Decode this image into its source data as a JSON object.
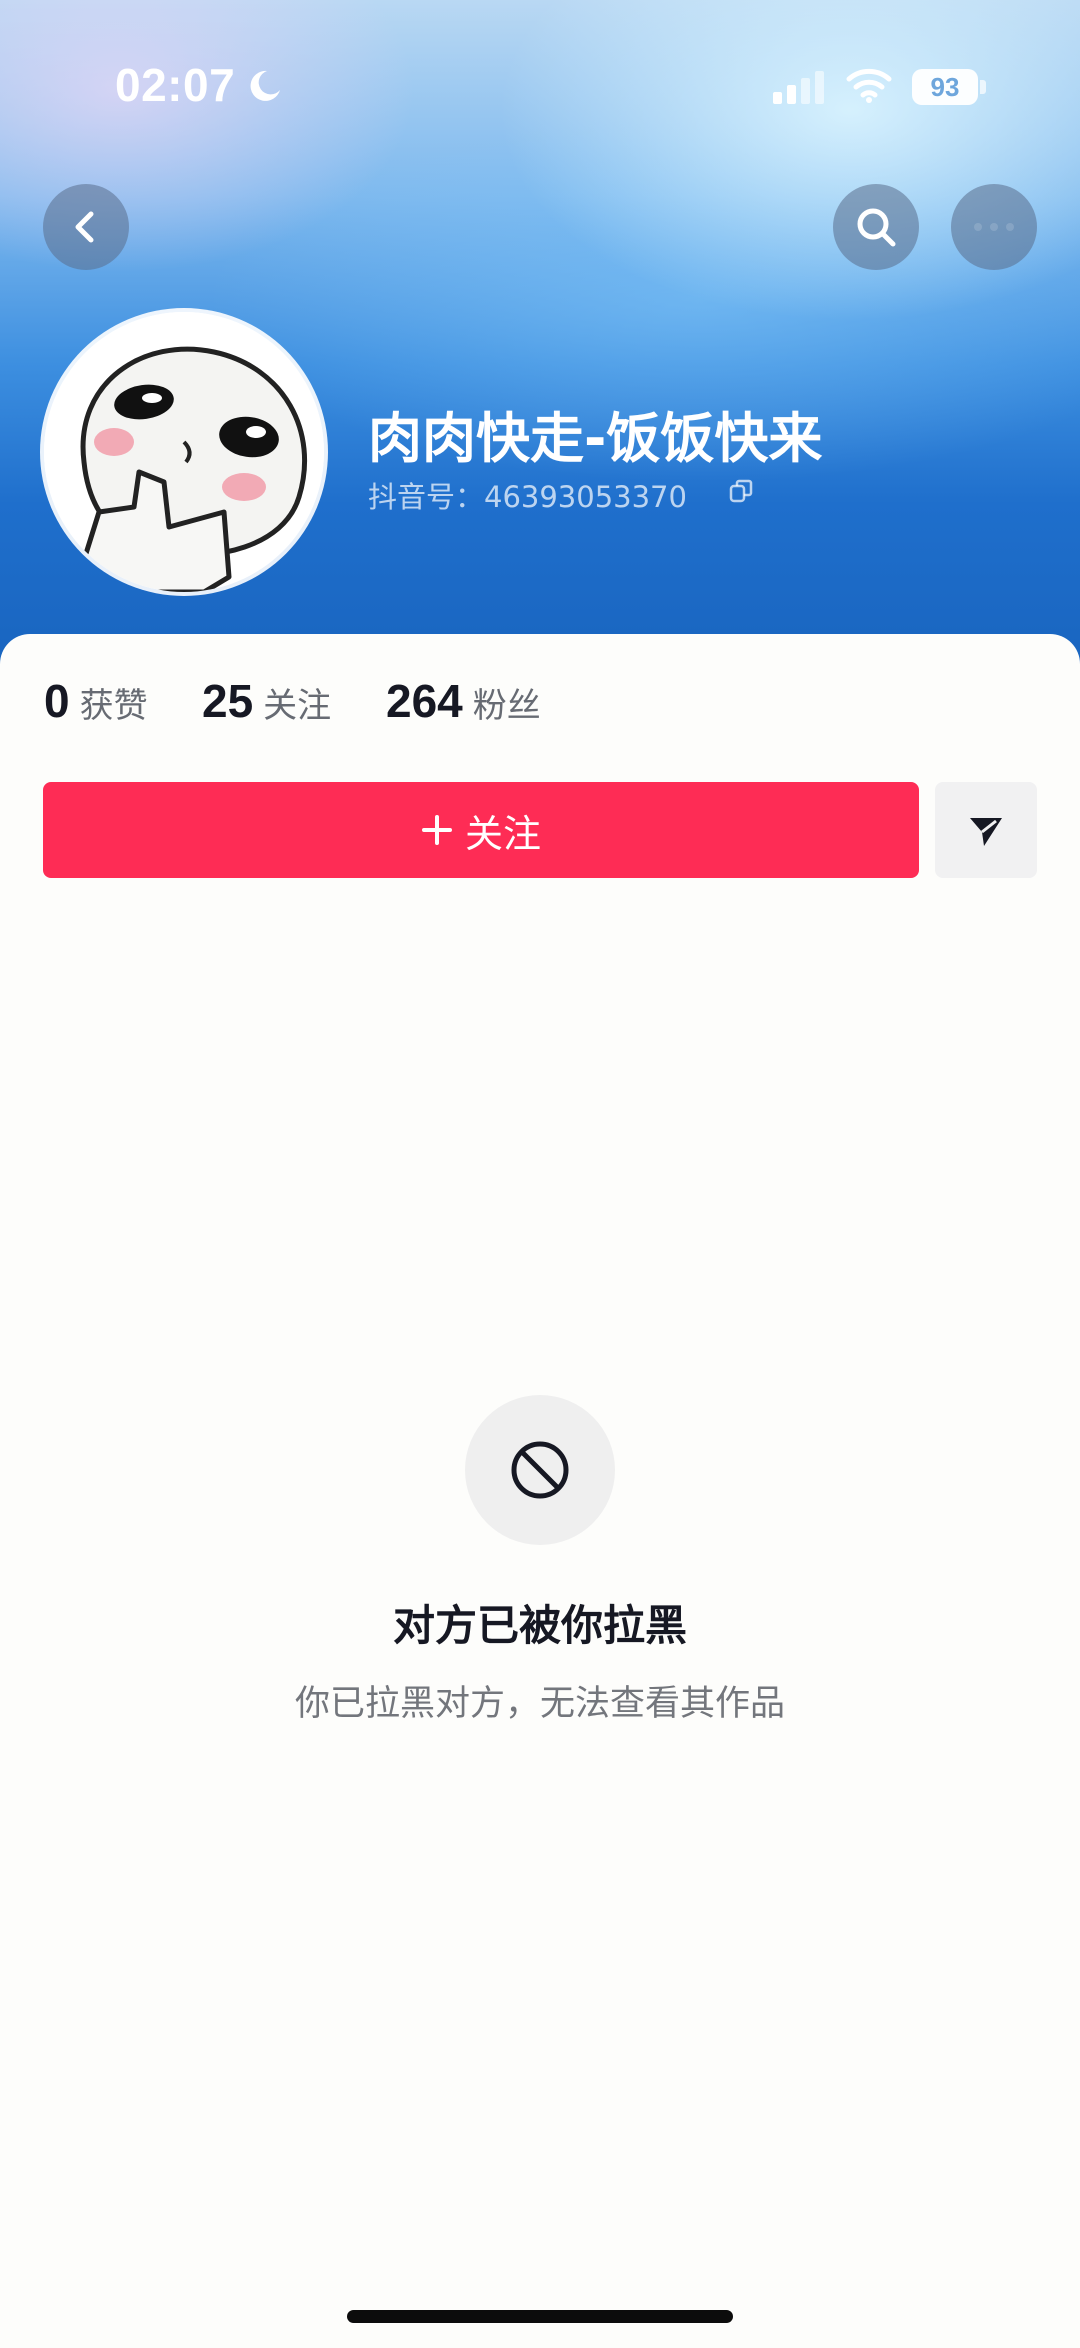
{
  "status_bar": {
    "time": "02:07",
    "battery": "93"
  },
  "profile": {
    "username": "肉肉快走-饭饭快来",
    "douyin_id": "抖音号：46393053370"
  },
  "stats": [
    {
      "value": "0",
      "label": "获赞"
    },
    {
      "value": "25",
      "label": "关注"
    },
    {
      "value": "264",
      "label": "粉丝"
    }
  ],
  "actions": {
    "follow_label": "关注"
  },
  "blocked": {
    "title": "对方已被你拉黑",
    "subtitle": "你已拉黑对方，无法查看其作品"
  },
  "colors": {
    "accent": "#fe2c55",
    "header_top": "#b9d8f3",
    "header_bottom": "#1863bd"
  },
  "icons": [
    "moon-icon",
    "signal-icon",
    "wifi-icon",
    "back-arrow-icon",
    "search-icon",
    "more-icon",
    "copy-icon",
    "plus-icon",
    "send-icon",
    "block-icon"
  ]
}
